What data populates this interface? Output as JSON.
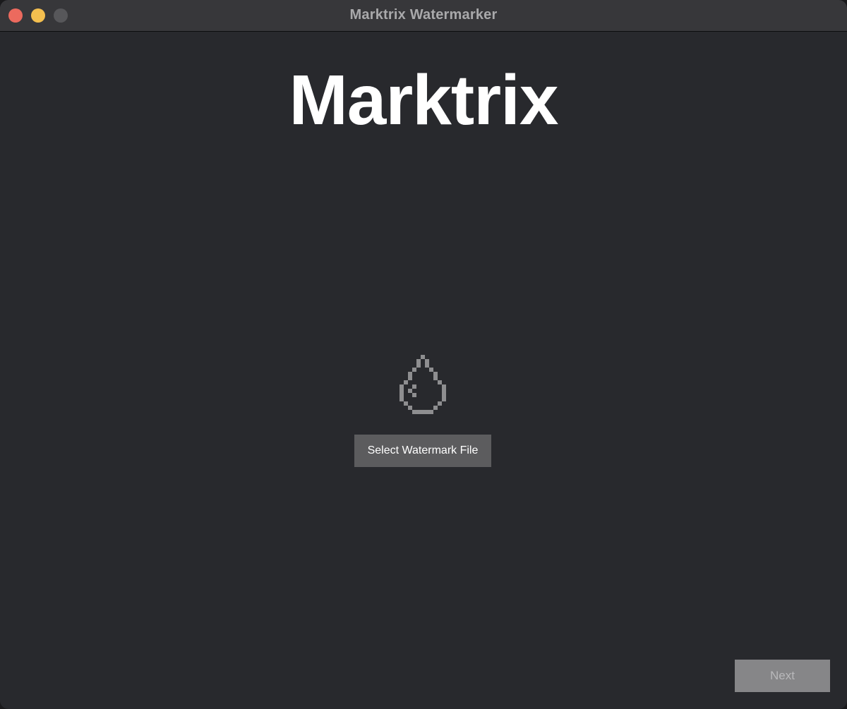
{
  "window": {
    "title": "Marktrix Watermarker"
  },
  "main": {
    "heading": "Marktrix",
    "icon": "water-drop-icon",
    "select_button_label": "Select Watermark File"
  },
  "footer": {
    "next_label": "Next"
  },
  "colors": {
    "background": "#28292d",
    "titlebar": "#37373a",
    "close": "#ec6a5e",
    "minimize": "#f4bf4f",
    "maximize": "#57575a",
    "select_button": "#5c5c5e",
    "next_button": "#868688",
    "icon": "#8e8e90"
  }
}
